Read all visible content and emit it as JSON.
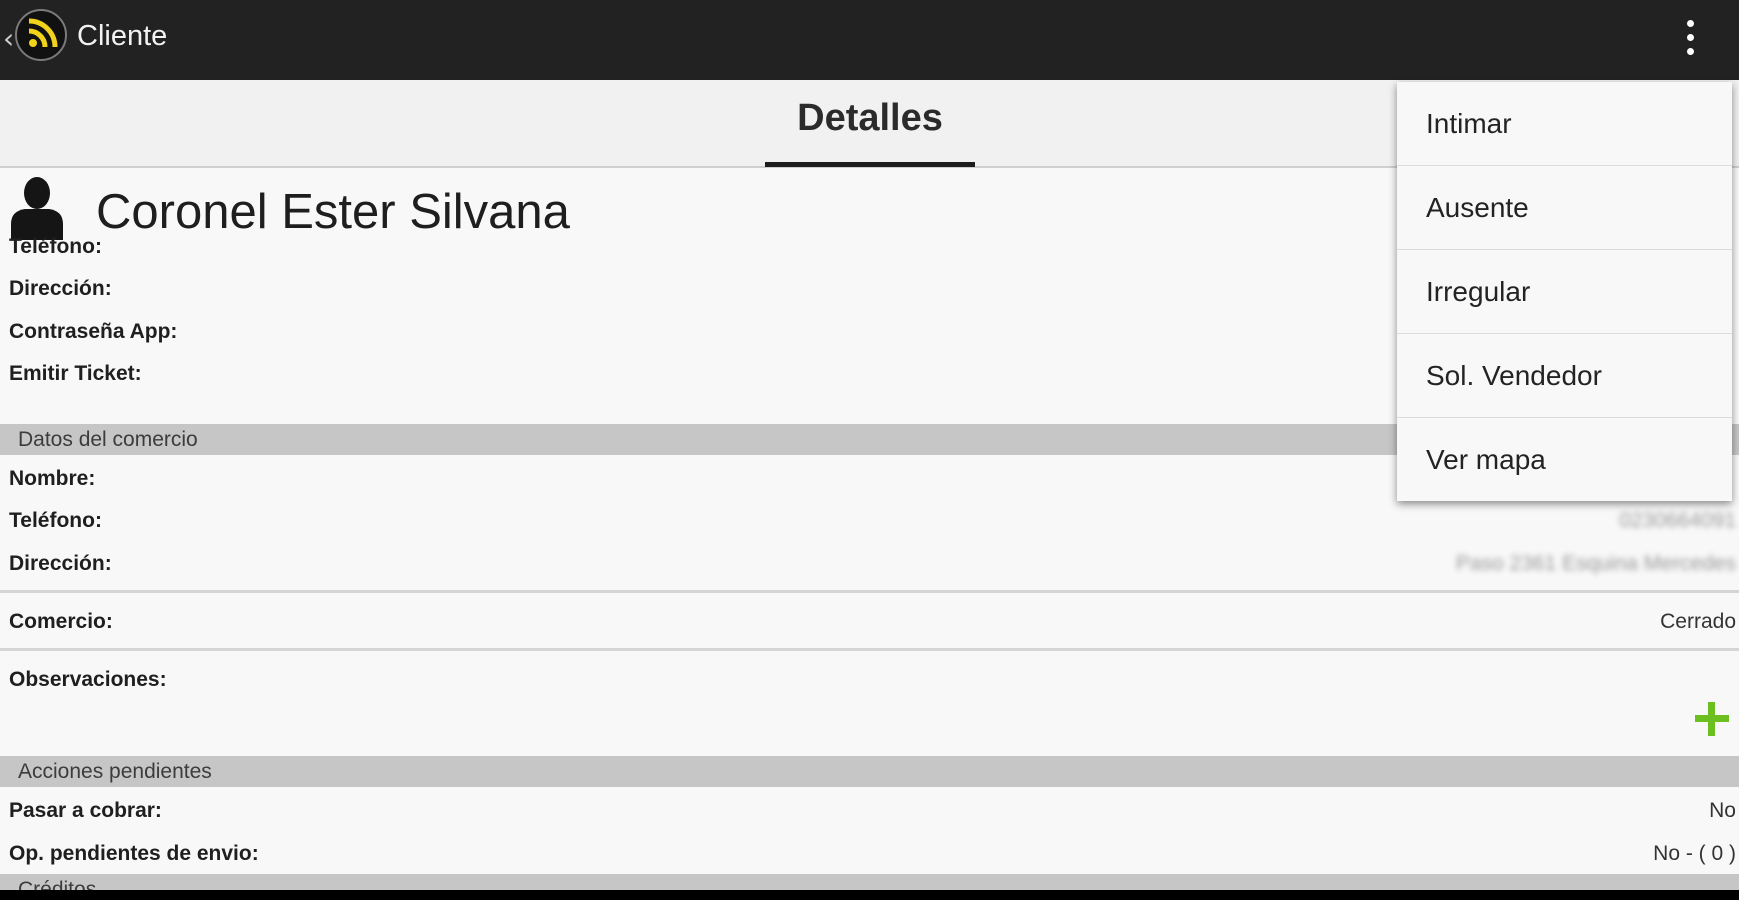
{
  "appbar": {
    "title": "Cliente",
    "back_glyph": "‹"
  },
  "tabs": {
    "active_label": "Detalles"
  },
  "client": {
    "name": "Coronel Ester Silvana"
  },
  "fields": [
    {
      "label": "Teléfono:",
      "value": ""
    },
    {
      "label": "Dirección:",
      "value": ""
    },
    {
      "label": "Contraseña App:",
      "value": ""
    },
    {
      "label": "Emitir Ticket:",
      "value": ""
    }
  ],
  "commerce_section": {
    "title": "Datos del comercio",
    "fields": [
      {
        "label": "Nombre:",
        "value": ""
      },
      {
        "label": "Teléfono:",
        "value": "0230664091"
      },
      {
        "label": "Dirección:",
        "value": "Paso 2361 Esquina Mercedes"
      }
    ]
  },
  "status": {
    "label": "Comercio:",
    "value": "Cerrado"
  },
  "observations": {
    "label": "Observaciones:"
  },
  "pending_section": {
    "title": "Acciones pendientes",
    "fields": [
      {
        "label": "Pasar a cobrar:",
        "value": "No"
      },
      {
        "label": "Op. pendientes de envio:",
        "value": "No - ( 0 )"
      }
    ]
  },
  "credits_section": {
    "title": "Créditos"
  },
  "menu": {
    "items": [
      "Intimar",
      "Ausente",
      "Irregular",
      "Sol. Vendedor",
      "Ver mapa"
    ]
  },
  "colors": {
    "appbar": "#222222",
    "accent_green": "#6cbf1e",
    "logo_yellow": "#f2d31b",
    "section_bg": "#c6c6c6"
  }
}
